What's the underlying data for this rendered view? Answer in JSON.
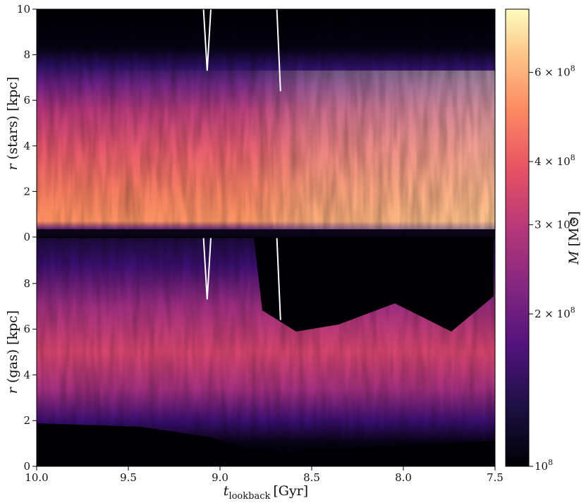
{
  "chart_data": {
    "type": "heatmap",
    "colormap": "magma",
    "x_axis": {
      "label_main": "t",
      "label_sub": "lookback",
      "label_unit": "[Gyr]",
      "range": [
        10.0,
        7.5
      ],
      "inverted": true,
      "ticks": [
        "10.0",
        "9.5",
        "9.0",
        "8.5",
        "8.0",
        "7.5"
      ],
      "tick_values": [
        10.0,
        9.5,
        9.0,
        8.5,
        8.0,
        7.5
      ]
    },
    "panels": [
      {
        "id": "stars",
        "ylabel_var": "r",
        "ylabel_text": " (stars) [kpc]",
        "ylim": [
          0,
          10
        ],
        "ticks": [
          "0",
          "2",
          "4",
          "6",
          "8",
          "10"
        ],
        "tick_values": [
          0,
          2,
          4,
          6,
          8,
          10
        ]
      },
      {
        "id": "gas",
        "ylabel_var": "r",
        "ylabel_text": " (gas) [kpc]",
        "ylim": [
          0,
          10
        ],
        "ticks": [
          "0",
          "2",
          "4",
          "6",
          "8"
        ],
        "tick_values": [
          0,
          2,
          4,
          6,
          8
        ]
      }
    ],
    "colorbar": {
      "label_var": "M",
      "label_unit": " [M⊙]",
      "scale": "log",
      "range": [
        100000000.0,
        800000000.0
      ],
      "ticks": [
        {
          "value": 100000000.0,
          "mantissa": "",
          "exp": "8"
        },
        {
          "value": 200000000.0,
          "mantissa": "2",
          "exp": "8"
        },
        {
          "value": 300000000.0,
          "mantissa": "3",
          "exp": "8"
        },
        {
          "value": 400000000.0,
          "mantissa": "4",
          "exp": "8"
        },
        {
          "value": 600000000.0,
          "mantissa": "6",
          "exp": "8"
        }
      ]
    },
    "overlay_lines": [
      {
        "panel": "stars",
        "color": "#ffffff",
        "points": [
          [
            9.09,
            10.0
          ],
          [
            9.07,
            7.3
          ],
          [
            9.05,
            10.0
          ]
        ]
      },
      {
        "panel": "stars",
        "color": "#ffffff",
        "points": [
          [
            8.69,
            10.0
          ],
          [
            8.67,
            6.4
          ]
        ]
      },
      {
        "panel": "gas",
        "color": "#ffffff",
        "points": [
          [
            9.09,
            10.0
          ],
          [
            9.07,
            7.3
          ],
          [
            9.05,
            10.0
          ]
        ]
      },
      {
        "panel": "gas",
        "color": "#ffffff",
        "points": [
          [
            8.69,
            10.0
          ],
          [
            8.67,
            6.4
          ]
        ]
      }
    ]
  }
}
